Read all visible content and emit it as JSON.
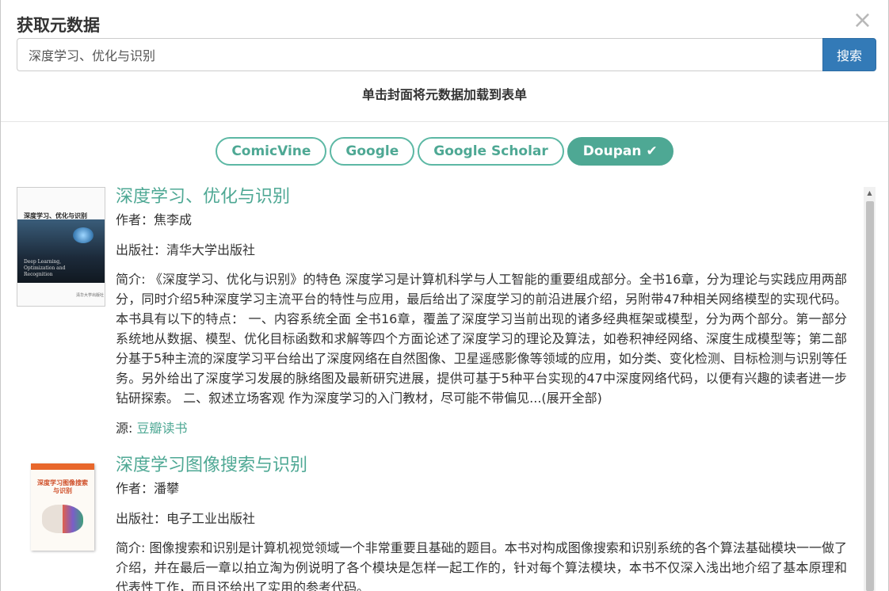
{
  "dialog": {
    "title": "获取元数据",
    "close_glyph": "×"
  },
  "search": {
    "value": "深度学习、优化与识别",
    "button_label": "搜索"
  },
  "hint": "单击封面将元数据加载到表单",
  "sources": [
    {
      "label": "ComicVine",
      "active": false
    },
    {
      "label": "Google",
      "active": false
    },
    {
      "label": "Google Scholar",
      "active": false
    },
    {
      "label": "Doupan",
      "active": true
    }
  ],
  "colors": {
    "accent": "#4ea894",
    "primary_button": "#337ab7"
  },
  "icons": {
    "check": "check-icon",
    "close": "close-icon"
  },
  "books": [
    {
      "title": "深度学习、优化与识别",
      "author_label": "作者：",
      "author": "焦李成",
      "publisher_label": "出版社：",
      "publisher": "清华大学出版社",
      "description_label": "简介: ",
      "description": "《深度学习、优化与识别》的特色 深度学习是计算机科学与人工智能的重要组成部分。全书16章，分为理论与实践应用两部分，同时介绍5种深度学习主流平台的特性与应用，最后给出了深度学习的前沿进展介绍，另附带47种相关网络模型的实现代码。本书具有以下的特点： 一、内容系统全面 全书16章，覆盖了深度学习当前出现的诸多经典框架或模型，分为两个部分。第一部分系统地从数据、模型、优化目标函数和求解等四个方面论述了深度学习的理论及算法，如卷积神经网络、深度生成模型等；第二部分基于5种主流的深度学习平台给出了深度网络在自然图像、卫星遥感影像等领域的应用，如分类、变化检测、目标检测与识别等任务。另外给出了深度学习发展的脉络图及最新研究进展，提供可基于5种平台实现的47中深度网络代码，以便有兴趣的读者进一步钻研探索。 二、叙述立场客观 作为深度学习的入门教材，尽可能不带偏见...(展开全部)",
      "source_label": "源: ",
      "source": "豆瓣读书",
      "cover": {
        "cn_title": "深度学习、优化与识别",
        "en_title": "Deep Learning, Optimization and Recognition",
        "publisher": "清华大学出版社"
      }
    },
    {
      "title": "深度学习图像搜索与识别",
      "author_label": "作者：",
      "author": "潘攀",
      "publisher_label": "出版社：",
      "publisher": "电子工业出版社",
      "description_label": "简介: ",
      "description": "图像搜索和识别是计算机视觉领域一个非常重要且基础的题目。本书对构成图像搜索和识别系统的各个算法基础模块一一做了介绍，并在最后一章以拍立淘为例说明了各个模块是怎样一起工作的，针对每个算法模块，本书不仅深入浅出地介绍了基本原理和代表性工作，而且还给出了实用的参考代码。",
      "cover": {
        "cn_title": "深度学习图像搜索与识别"
      }
    }
  ]
}
